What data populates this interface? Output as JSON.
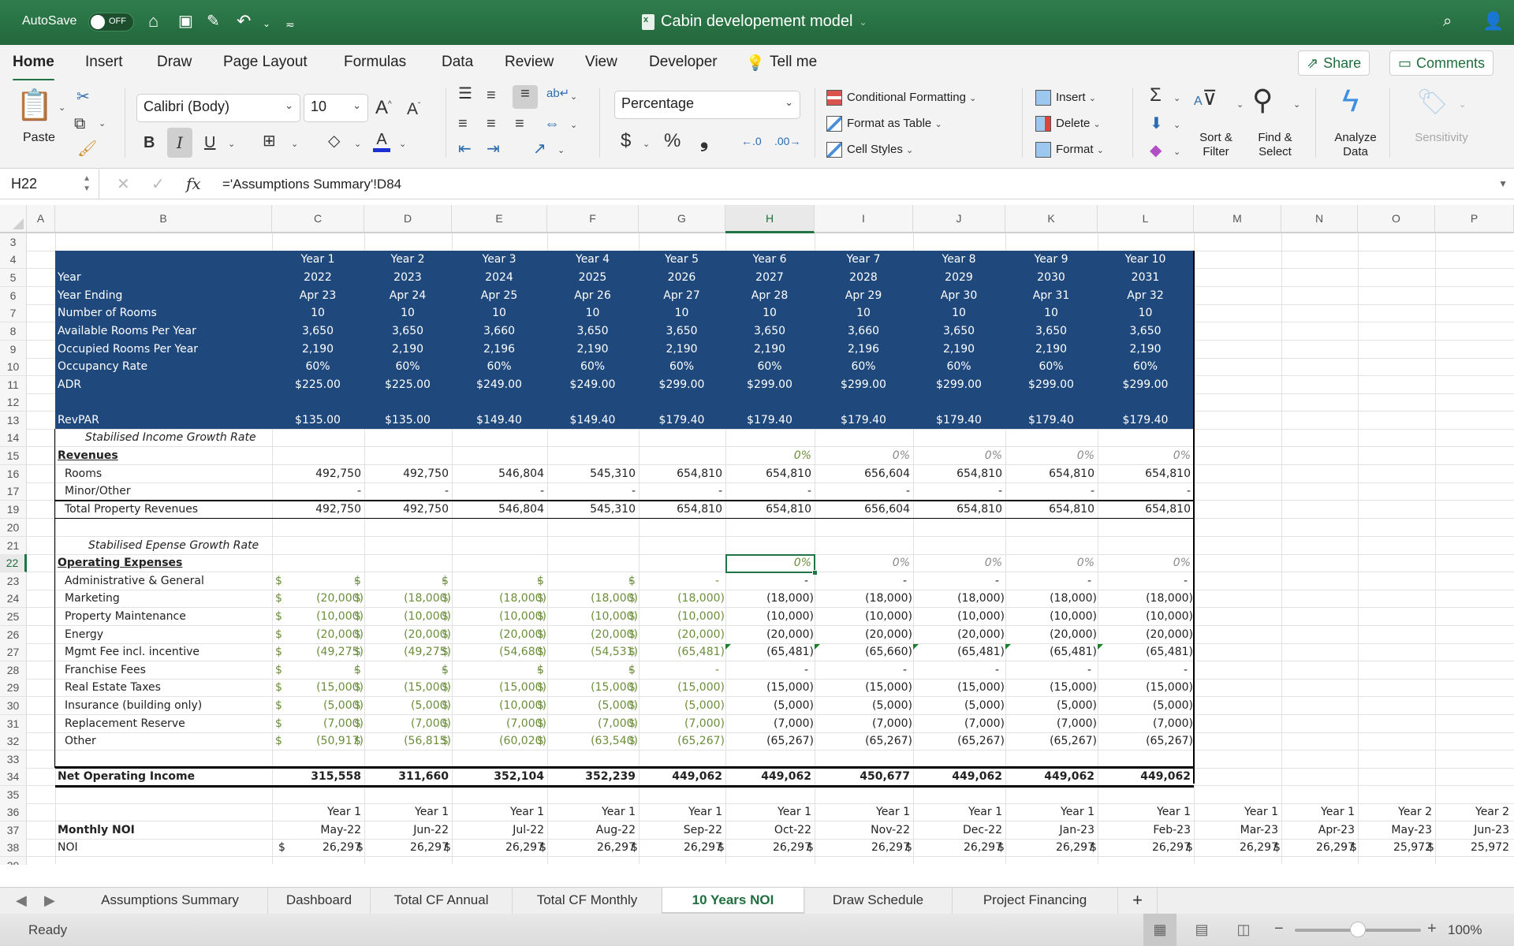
{
  "titlebar": {
    "autosave_label": "AutoSave",
    "autosave_state": "OFF",
    "doc_title": "Cabin developement model",
    "icons": [
      "home-icon",
      "save-icon",
      "edit-icon",
      "undo-icon",
      "customize-icon",
      "search-icon",
      "account-icon"
    ]
  },
  "menu_tabs": [
    "Home",
    "Insert",
    "Draw",
    "Page Layout",
    "Formulas",
    "Data",
    "Review",
    "View",
    "Developer"
  ],
  "active_tab": "Home",
  "tell_me": "Tell me",
  "share_label": "Share",
  "comments_label": "Comments",
  "ribbon": {
    "paste": "Paste",
    "font_name": "Calibri (Body)",
    "font_size": "10",
    "bold": "B",
    "italic": "I",
    "underline": "U",
    "number_format": "Percentage",
    "currency": "$",
    "percent": "%",
    "comma": "❟",
    "conditional_formatting": "Conditional Formatting",
    "format_as_table": "Format as Table",
    "cell_styles": "Cell Styles",
    "insert": "Insert",
    "delete": "Delete",
    "format": "Format",
    "sort_filter": [
      "Sort &",
      "Filter"
    ],
    "find_select": [
      "Find &",
      "Select"
    ],
    "analyze_data": [
      "Analyze",
      "Data"
    ],
    "sensitivity": "Sensitivity"
  },
  "formula_bar": {
    "name_box": "H22",
    "formula": "='Assumptions Summary'!D84"
  },
  "columns": [
    "A",
    "B",
    "C",
    "D",
    "E",
    "F",
    "G",
    "H",
    "I",
    "J",
    "K",
    "L",
    "M",
    "N",
    "O",
    "P"
  ],
  "selected_column": "H",
  "rows": [
    "3",
    "4",
    "5",
    "6",
    "7",
    "8",
    "9",
    "10",
    "11",
    "12",
    "13",
    "14",
    "15",
    "16",
    "17",
    "19",
    "20",
    "21",
    "22",
    "23",
    "24",
    "25",
    "26",
    "27",
    "28",
    "29",
    "30",
    "31",
    "32",
    "33",
    "34",
    "35",
    "36",
    "37",
    "38",
    "39"
  ],
  "selected_row": "22",
  "summary": {
    "year_headers": [
      "Year 1",
      "Year 2",
      "Year 3",
      "Year 4",
      "Year 5",
      "Year 6",
      "Year 7",
      "Year 8",
      "Year 9",
      "Year 10"
    ],
    "rows": [
      {
        "label": "Year",
        "values": [
          "2022",
          "2023",
          "2024",
          "2025",
          "2026",
          "2027",
          "2028",
          "2029",
          "2030",
          "2031"
        ]
      },
      {
        "label": "Year Ending",
        "values": [
          "Apr 23",
          "Apr 24",
          "Apr 25",
          "Apr 26",
          "Apr 27",
          "Apr 28",
          "Apr 29",
          "Apr 30",
          "Apr 31",
          "Apr 32"
        ]
      },
      {
        "label": "Number of Rooms",
        "values": [
          "10",
          "10",
          "10",
          "10",
          "10",
          "10",
          "10",
          "10",
          "10",
          "10"
        ]
      },
      {
        "label": "Available Rooms Per Year",
        "values": [
          "3,650",
          "3,650",
          "3,660",
          "3,650",
          "3,650",
          "3,650",
          "3,660",
          "3,650",
          "3,650",
          "3,650"
        ]
      },
      {
        "label": "Occupied Rooms Per Year",
        "values": [
          "2,190",
          "2,190",
          "2,196",
          "2,190",
          "2,190",
          "2,190",
          "2,196",
          "2,190",
          "2,190",
          "2,190"
        ]
      },
      {
        "label": "Occupancy Rate",
        "values": [
          "60%",
          "60%",
          "60%",
          "60%",
          "60%",
          "60%",
          "60%",
          "60%",
          "60%",
          "60%"
        ]
      },
      {
        "label": "ADR",
        "values": [
          "$225.00",
          "$225.00",
          "$249.00",
          "$249.00",
          "$299.00",
          "$299.00",
          "$299.00",
          "$299.00",
          "$299.00",
          "$299.00"
        ]
      }
    ],
    "revpar": {
      "label": "RevPAR",
      "values": [
        "$135.00",
        "$135.00",
        "$149.40",
        "$149.40",
        "$179.40",
        "$179.40",
        "$179.40",
        "$179.40",
        "$179.40",
        "$179.40"
      ]
    }
  },
  "income": {
    "growth_label": "Stabilised Income Growth Rate",
    "growth_rates": [
      "",
      "",
      "",
      "",
      "",
      "0%",
      "0%",
      "0%",
      "0%",
      "0%"
    ],
    "section_label": "Revenues",
    "rooms": {
      "label": "Rooms",
      "values": [
        "492,750",
        "492,750",
        "546,804",
        "545,310",
        "654,810",
        "654,810",
        "656,604",
        "654,810",
        "654,810",
        "654,810"
      ]
    },
    "minor": {
      "label": "Minor/Other",
      "values": [
        "-",
        "-",
        "-",
        "-",
        "-",
        "-",
        "-",
        "-",
        "-",
        "-"
      ]
    },
    "total": {
      "label": "Total Property Revenues",
      "values": [
        "492,750",
        "492,750",
        "546,804",
        "545,310",
        "654,810",
        "654,810",
        "656,604",
        "654,810",
        "654,810",
        "654,810"
      ]
    }
  },
  "expenses": {
    "growth_label": "Stabilised Epense Growth Rate",
    "growth_rates": [
      "",
      "",
      "",
      "",
      "",
      "0%",
      "0%",
      "0%",
      "0%",
      "0%"
    ],
    "section_label": "Operating Expenses",
    "currency_symbol": "$",
    "lines": [
      {
        "label": "Administrative & General",
        "values": [
          "-",
          "-",
          "-",
          "-",
          "-",
          "-",
          "-",
          "-",
          "-",
          "-"
        ]
      },
      {
        "label": "Marketing",
        "values": [
          "(20,000)",
          "(18,000)",
          "(18,000)",
          "(18,000)",
          "(18,000)",
          "(18,000)",
          "(18,000)",
          "(18,000)",
          "(18,000)",
          "(18,000)"
        ]
      },
      {
        "label": "Property Maintenance",
        "values": [
          "(10,000)",
          "(10,000)",
          "(10,000)",
          "(10,000)",
          "(10,000)",
          "(10,000)",
          "(10,000)",
          "(10,000)",
          "(10,000)",
          "(10,000)"
        ]
      },
      {
        "label": " Energy",
        "values": [
          "(20,000)",
          "(20,000)",
          "(20,000)",
          "(20,000)",
          "(20,000)",
          "(20,000)",
          "(20,000)",
          "(20,000)",
          "(20,000)",
          "(20,000)"
        ]
      },
      {
        "label": "Mgmt Fee incl. incentive",
        "values": [
          "(49,275)",
          "(49,275)",
          "(54,680)",
          "(54,531)",
          "(65,481)",
          "(65,481)",
          "(65,660)",
          "(65,481)",
          "(65,481)",
          "(65,481)"
        ]
      },
      {
        "label": "Franchise Fees",
        "values": [
          "-",
          "-",
          "-",
          "-",
          "-",
          "-",
          "-",
          "-",
          "-",
          "-"
        ]
      },
      {
        "label": "Real Estate Taxes",
        "values": [
          "(15,000)",
          "(15,000)",
          "(15,000)",
          "(15,000)",
          "(15,000)",
          "(15,000)",
          "(15,000)",
          "(15,000)",
          "(15,000)",
          "(15,000)"
        ]
      },
      {
        "label": "Insurance (building only)",
        "values": [
          "(5,000)",
          "(5,000)",
          "(10,000)",
          "(5,000)",
          "(5,000)",
          "(5,000)",
          "(5,000)",
          "(5,000)",
          "(5,000)",
          "(5,000)"
        ]
      },
      {
        "label": "Replacement Reserve",
        "values": [
          "(7,000)",
          "(7,000)",
          "(7,000)",
          "(7,000)",
          "(7,000)",
          "(7,000)",
          "(7,000)",
          "(7,000)",
          "(7,000)",
          "(7,000)"
        ]
      },
      {
        "label": "Other",
        "values": [
          "(50,917)",
          "(56,815)",
          "(60,020)",
          "(63,540)",
          "(65,267)",
          "(65,267)",
          "(65,267)",
          "(65,267)",
          "(65,267)",
          "(65,267)"
        ]
      }
    ]
  },
  "noi": {
    "label": "Net Operating Income",
    "values": [
      "315,558",
      "311,660",
      "352,104",
      "352,239",
      "449,062",
      "449,062",
      "450,677",
      "449,062",
      "449,062",
      "449,062"
    ]
  },
  "monthly": {
    "title": "Monthly NOI",
    "row_label": "NOI",
    "years": [
      "Year 1",
      "Year 1",
      "Year 1",
      "Year 1",
      "Year 1",
      "Year 1",
      "Year 1",
      "Year 1",
      "Year 1",
      "Year 1",
      "Year 1",
      "Year 1",
      "Year 2",
      "Year 2"
    ],
    "months": [
      "May-22",
      "Jun-22",
      "Jul-22",
      "Aug-22",
      "Sep-22",
      "Oct-22",
      "Nov-22",
      "Dec-22",
      "Jan-23",
      "Feb-23",
      "Mar-23",
      "Apr-23",
      "May-23",
      "Jun-23"
    ],
    "values": [
      "26,297",
      "26,297",
      "26,297",
      "26,297",
      "26,297",
      "26,297",
      "26,297",
      "26,297",
      "26,297",
      "26,297",
      "26,297",
      "26,297",
      "25,972",
      "25,972"
    ]
  },
  "sheet_tabs": [
    "Assumptions Summary",
    "Dashboard",
    "Total CF Annual",
    "Total CF Monthly",
    "10 Years NOI",
    "Draw Schedule",
    "Project Financing"
  ],
  "active_sheet": "10 Years NOI",
  "add_sheet": "+",
  "status": {
    "text": "Ready",
    "zoom": "100%",
    "zoom_fraction": 0.5
  }
}
